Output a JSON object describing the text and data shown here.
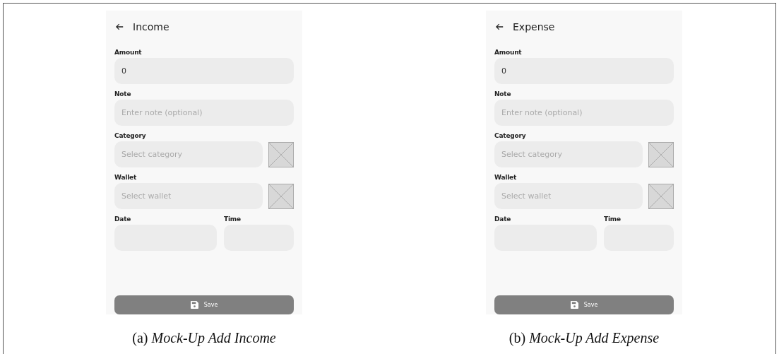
{
  "panels": [
    {
      "title": "Income",
      "fields": [
        {
          "label": "Amount",
          "value": "0",
          "image_slot": false
        },
        {
          "label": "Note",
          "placeholder": "Enter note (optional)",
          "image_slot": false
        },
        {
          "label": "Category",
          "placeholder": "Select category",
          "image_slot": true
        },
        {
          "label": "Wallet",
          "placeholder": "Select wallet",
          "image_slot": true
        }
      ],
      "date": {
        "label": "Date"
      },
      "time": {
        "label": "Time"
      },
      "save_button": "Save",
      "caption": "(a) *Mock-Up Add Income*"
    },
    {
      "title": "Expense",
      "fields": [
        {
          "label": "Amount",
          "value": "0",
          "image_slot": false
        },
        {
          "label": "Note",
          "placeholder": "Enter note (optional)",
          "image_slot": false
        },
        {
          "label": "Category",
          "placeholder": "Select category",
          "image_slot": true
        },
        {
          "label": "Wallet",
          "placeholder": "Select wallet",
          "image_slot": true
        }
      ],
      "date": {
        "label": "Date"
      },
      "time": {
        "label": "Time"
      },
      "save_button": "Save",
      "caption": "(b) *Mock-Up Add Expense*"
    }
  ]
}
